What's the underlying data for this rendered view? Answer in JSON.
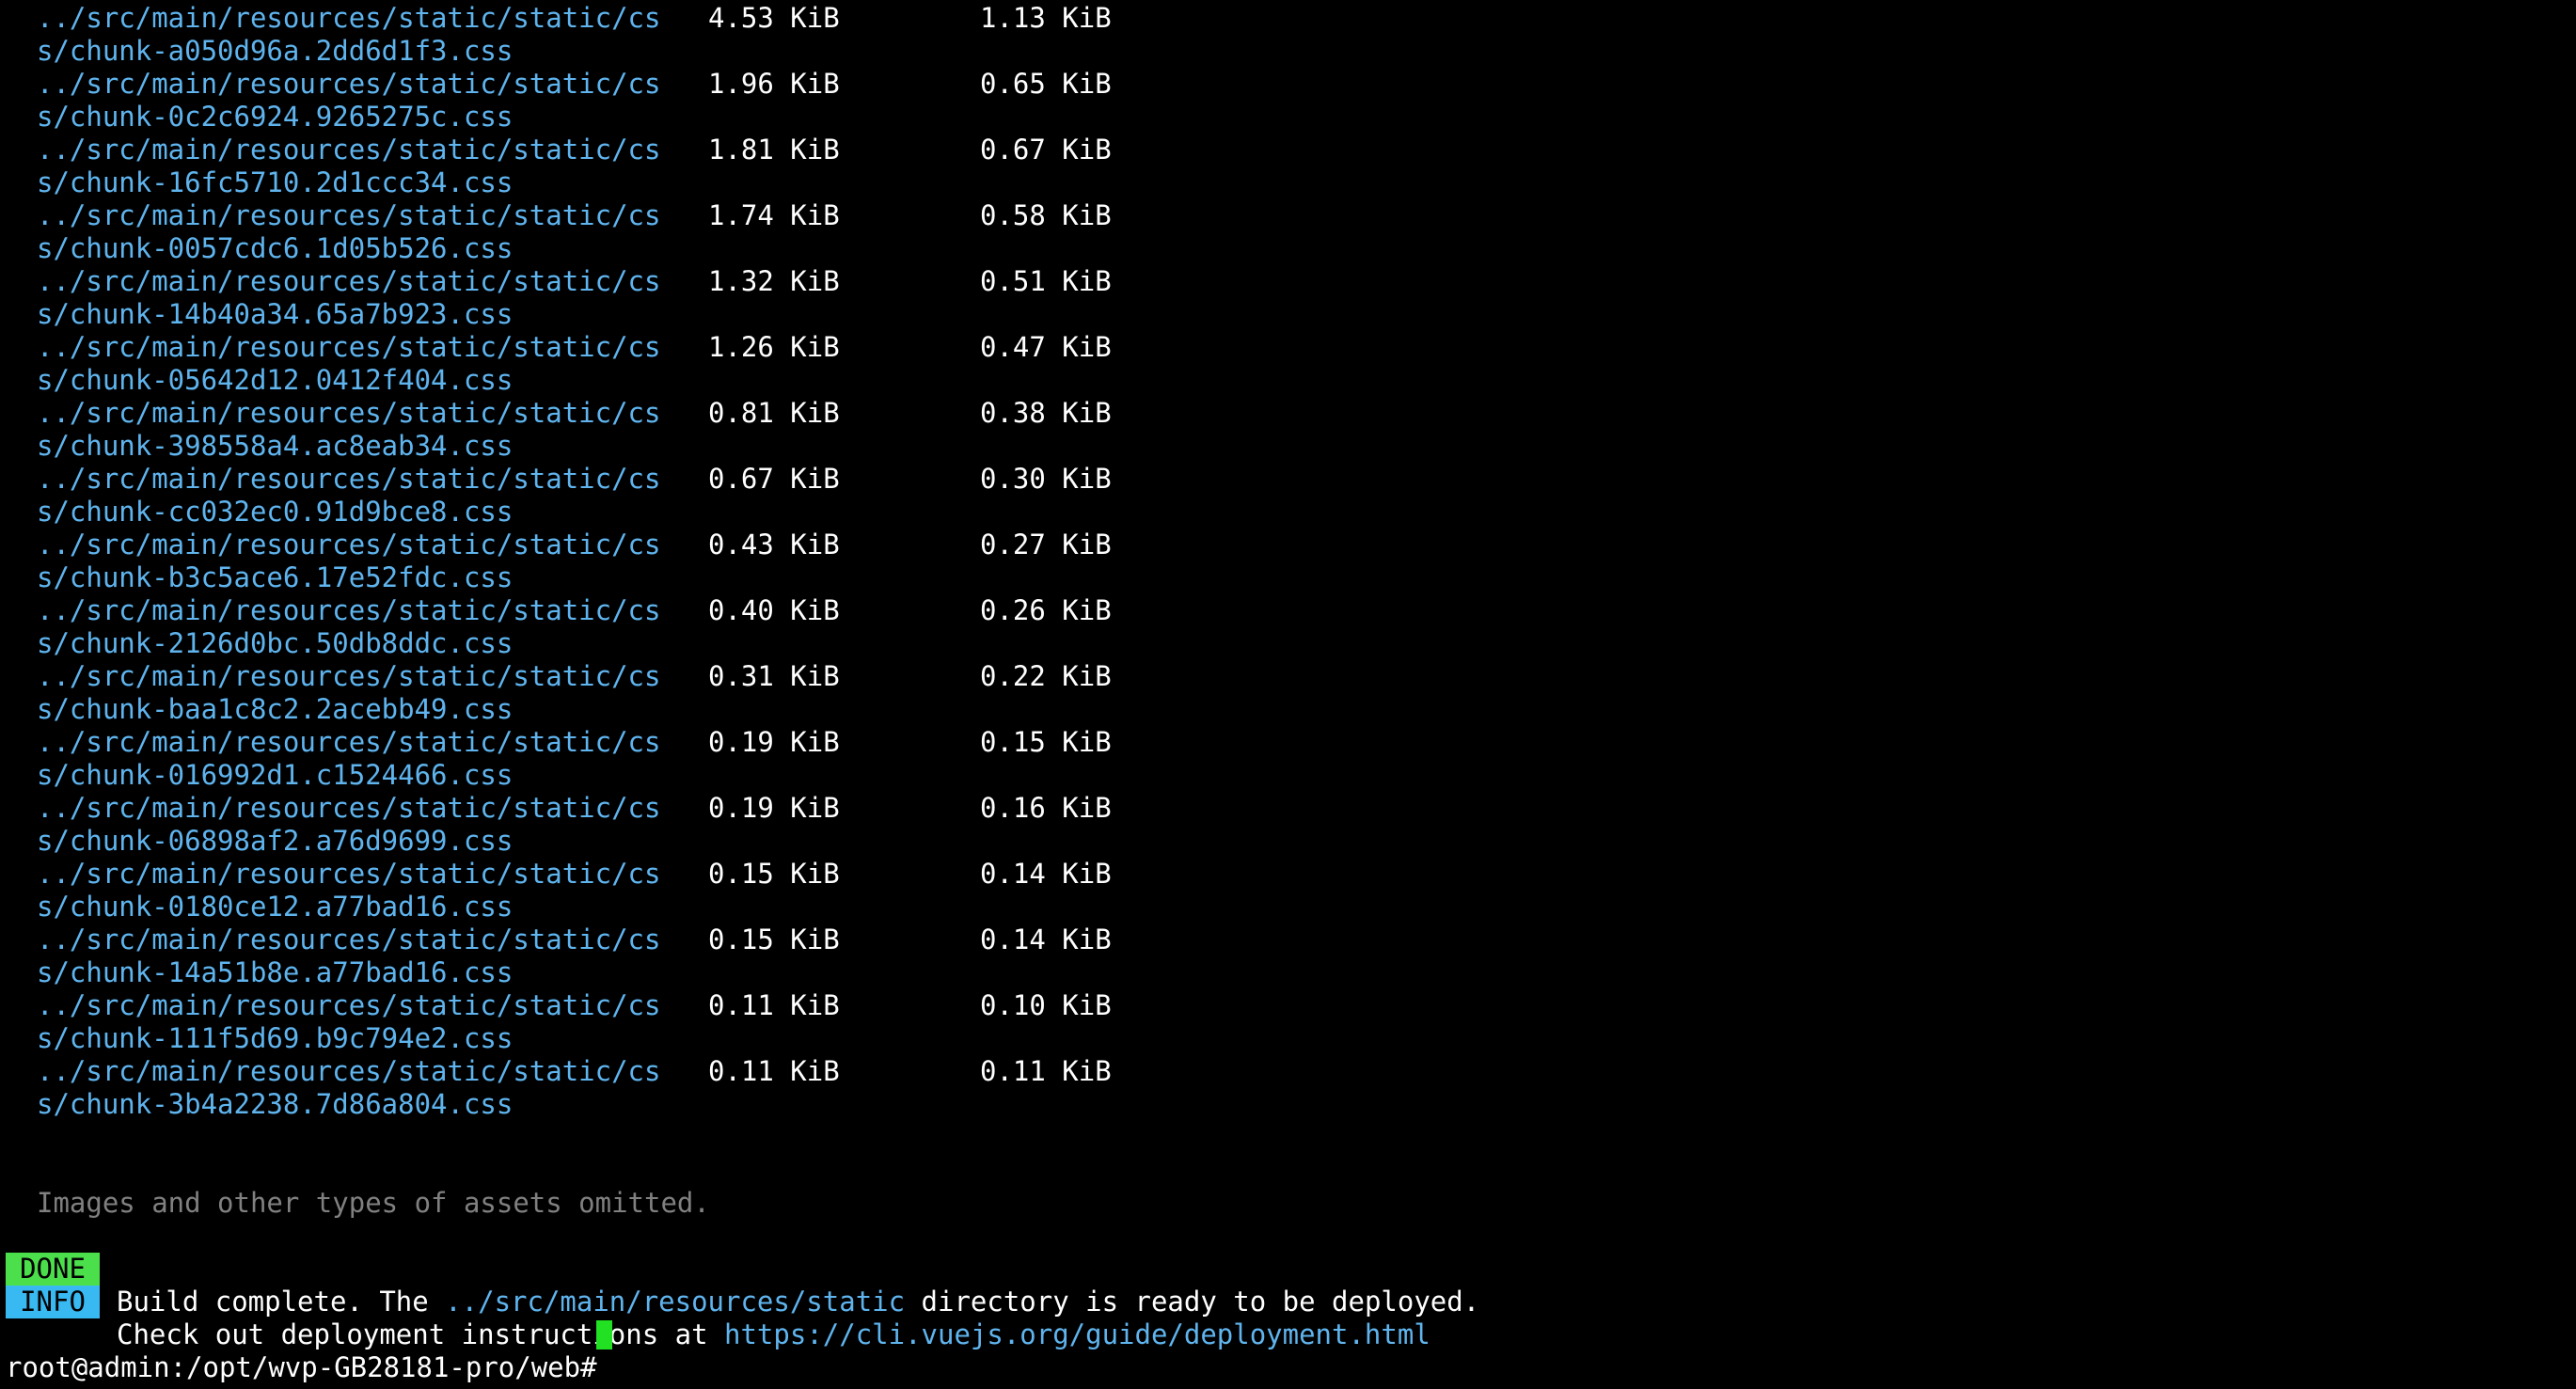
{
  "colors": {
    "background": "#000000",
    "text": "#ffffff",
    "path": "#5fb4ee",
    "dim": "#808080",
    "done_bg": "#4be04b",
    "info_bg": "#39b9f2",
    "cursor": "#22e022"
  },
  "assets": [
    {
      "path_line1": "../src/main/resources/static/static/cs",
      "path_line2": "s/chunk-a050d96a.2dd6d1f3.css",
      "size": "4.53 KiB",
      "gzipped": "1.13 KiB"
    },
    {
      "path_line1": "../src/main/resources/static/static/cs",
      "path_line2": "s/chunk-0c2c6924.9265275c.css",
      "size": "1.96 KiB",
      "gzipped": "0.65 KiB"
    },
    {
      "path_line1": "../src/main/resources/static/static/cs",
      "path_line2": "s/chunk-16fc5710.2d1ccc34.css",
      "size": "1.81 KiB",
      "gzipped": "0.67 KiB"
    },
    {
      "path_line1": "../src/main/resources/static/static/cs",
      "path_line2": "s/chunk-0057cdc6.1d05b526.css",
      "size": "1.74 KiB",
      "gzipped": "0.58 KiB"
    },
    {
      "path_line1": "../src/main/resources/static/static/cs",
      "path_line2": "s/chunk-14b40a34.65a7b923.css",
      "size": "1.32 KiB",
      "gzipped": "0.51 KiB"
    },
    {
      "path_line1": "../src/main/resources/static/static/cs",
      "path_line2": "s/chunk-05642d12.0412f404.css",
      "size": "1.26 KiB",
      "gzipped": "0.47 KiB"
    },
    {
      "path_line1": "../src/main/resources/static/static/cs",
      "path_line2": "s/chunk-398558a4.ac8eab34.css",
      "size": "0.81 KiB",
      "gzipped": "0.38 KiB"
    },
    {
      "path_line1": "../src/main/resources/static/static/cs",
      "path_line2": "s/chunk-cc032ec0.91d9bce8.css",
      "size": "0.67 KiB",
      "gzipped": "0.30 KiB"
    },
    {
      "path_line1": "../src/main/resources/static/static/cs",
      "path_line2": "s/chunk-b3c5ace6.17e52fdc.css",
      "size": "0.43 KiB",
      "gzipped": "0.27 KiB"
    },
    {
      "path_line1": "../src/main/resources/static/static/cs",
      "path_line2": "s/chunk-2126d0bc.50db8ddc.css",
      "size": "0.40 KiB",
      "gzipped": "0.26 KiB"
    },
    {
      "path_line1": "../src/main/resources/static/static/cs",
      "path_line2": "s/chunk-baa1c8c2.2acebb49.css",
      "size": "0.31 KiB",
      "gzipped": "0.22 KiB"
    },
    {
      "path_line1": "../src/main/resources/static/static/cs",
      "path_line2": "s/chunk-016992d1.c1524466.css",
      "size": "0.19 KiB",
      "gzipped": "0.15 KiB"
    },
    {
      "path_line1": "../src/main/resources/static/static/cs",
      "path_line2": "s/chunk-06898af2.a76d9699.css",
      "size": "0.19 KiB",
      "gzipped": "0.16 KiB"
    },
    {
      "path_line1": "../src/main/resources/static/static/cs",
      "path_line2": "s/chunk-0180ce12.a77bad16.css",
      "size": "0.15 KiB",
      "gzipped": "0.14 KiB"
    },
    {
      "path_line1": "../src/main/resources/static/static/cs",
      "path_line2": "s/chunk-14a51b8e.a77bad16.css",
      "size": "0.15 KiB",
      "gzipped": "0.14 KiB"
    },
    {
      "path_line1": "../src/main/resources/static/static/cs",
      "path_line2": "s/chunk-111f5d69.b9c794e2.css",
      "size": "0.11 KiB",
      "gzipped": "0.10 KiB"
    },
    {
      "path_line1": "../src/main/resources/static/static/cs",
      "path_line2": "s/chunk-3b4a2238.7d86a804.css",
      "size": "0.11 KiB",
      "gzipped": "0.11 KiB"
    }
  ],
  "omitted_note": "Images and other types of assets omitted.",
  "done": {
    "badge": "DONE",
    "text_before": "Build complete. The ",
    "dir": "../src/main/resources/static",
    "text_after": " directory is ready to be deployed."
  },
  "info": {
    "badge": "INFO",
    "text": "Check out deployment instructions at ",
    "url": "https://cli.vuejs.org/guide/deployment.html"
  },
  "prompt": "root@admin:/opt/wvp-GB28181-pro/web# "
}
